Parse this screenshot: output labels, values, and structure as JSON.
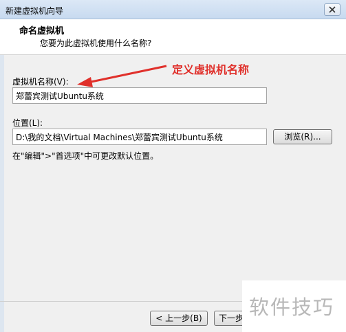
{
  "window": {
    "title": "新建虚拟机向导"
  },
  "header": {
    "title": "命名虚拟机",
    "subtitle": "您要为此虚拟机使用什么名称?"
  },
  "form": {
    "name_label": "虚拟机名称(V):",
    "name_value": "郑蕾宾测试Ubuntu系统",
    "location_label": "位置(L):",
    "location_value": "D:\\我的文档\\Virtual Machines\\郑蕾宾测试Ubuntu系统",
    "browse_label": "浏览(R)...",
    "hint": "在\"编辑\">\"首选项\"中可更改默认位置。"
  },
  "annotation": {
    "text": "定义虚拟机名称",
    "color": "#e0302b"
  },
  "footer": {
    "back_label": "< 上一步(B)",
    "next_label": "下一步"
  },
  "watermark": {
    "text": "软件技巧"
  },
  "icons": {
    "close": "close-icon",
    "arrow": "arrow-annotation-icon"
  }
}
